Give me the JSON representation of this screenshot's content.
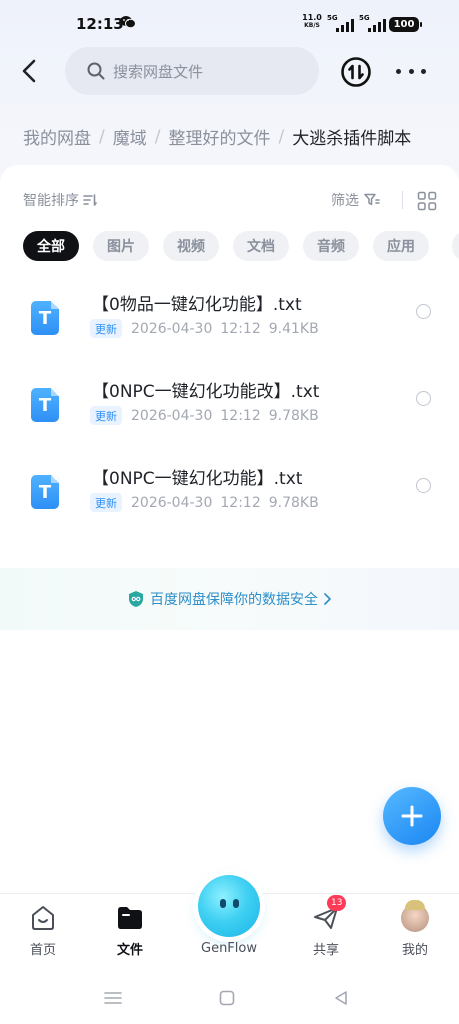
{
  "status_bar": {
    "time": "12:13",
    "net_speed_value": "11.0",
    "net_speed_unit": "KB/S",
    "signal1_label": "5G",
    "signal2_label": "5G",
    "battery": "100"
  },
  "header": {
    "search_placeholder": "搜索网盘文件"
  },
  "breadcrumb": [
    {
      "label": "我的网盘"
    },
    {
      "label": "魔域"
    },
    {
      "label": "整理好的文件"
    },
    {
      "label": "大逃杀插件脚本"
    }
  ],
  "toolbar": {
    "sort_label": "智能排序",
    "filter_label": "筛选"
  },
  "tabs": [
    {
      "label": "全部",
      "active": true
    },
    {
      "label": "图片"
    },
    {
      "label": "视频"
    },
    {
      "label": "文档"
    },
    {
      "label": "音频"
    },
    {
      "label": "应用"
    }
  ],
  "files": [
    {
      "icon_letter": "T",
      "name": "【0物品一键幻化功能】.txt",
      "badge": "更新",
      "date": "2026-04-30",
      "time": "12:12",
      "size": "9.41KB"
    },
    {
      "icon_letter": "T",
      "name": "【0NPC一键幻化功能改】.txt",
      "badge": "更新",
      "date": "2026-04-30",
      "time": "12:12",
      "size": "9.78KB"
    },
    {
      "icon_letter": "T",
      "name": "【0NPC一键幻化功能】.txt",
      "badge": "更新",
      "date": "2026-04-30",
      "time": "12:12",
      "size": "9.78KB"
    }
  ],
  "security_banner": {
    "text": "百度网盘保障你的数据安全"
  },
  "bottom_nav": {
    "home": "首页",
    "files": "文件",
    "genflow": "GenFlow",
    "share": "共享",
    "share_badge": "13",
    "mine": "我的"
  },
  "colors": {
    "accent": "#2e8ff5",
    "active_tab": "#0f1115",
    "badge_red": "#ff3b57",
    "genflow": "#3fd0f2"
  }
}
